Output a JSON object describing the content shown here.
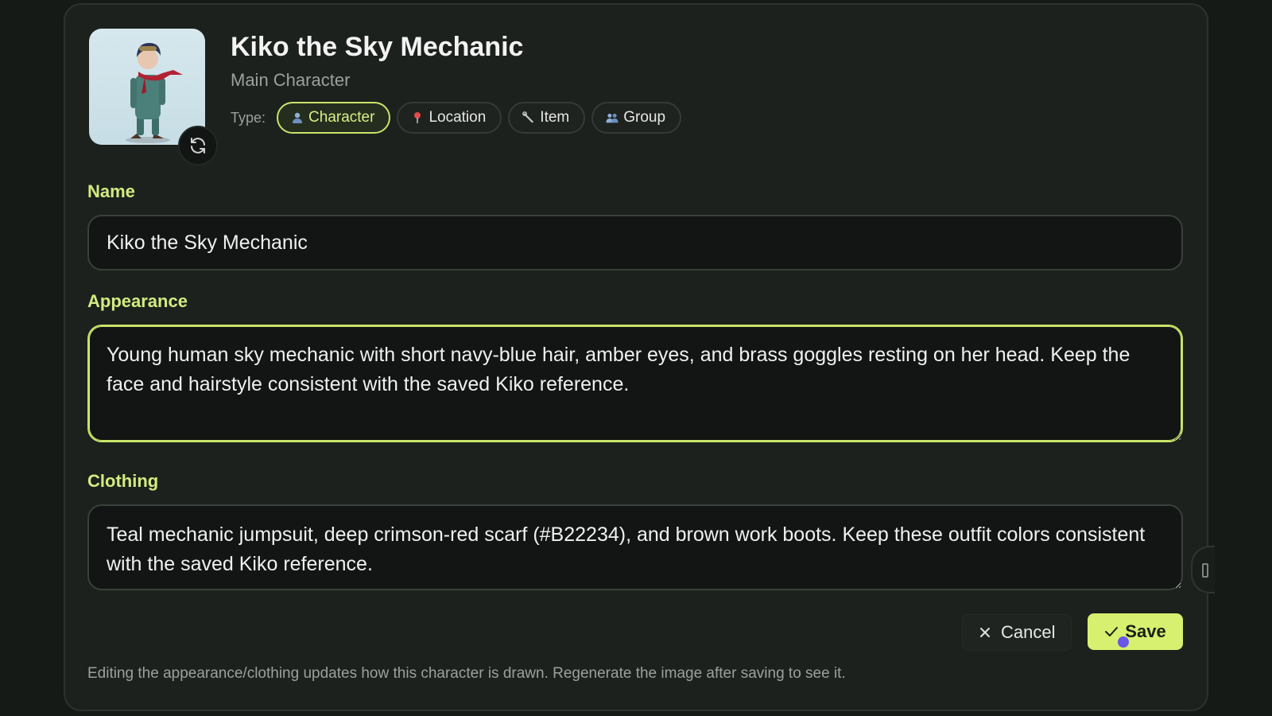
{
  "header": {
    "title": "Kiko the Sky Mechanic",
    "subtitle": "Main Character",
    "type_label": "Type:",
    "types": [
      {
        "label": "Character",
        "icon": "person-icon",
        "active": true
      },
      {
        "label": "Location",
        "icon": "pin-icon",
        "active": false
      },
      {
        "label": "Item",
        "icon": "wrench-icon",
        "active": false
      },
      {
        "label": "Group",
        "icon": "group-icon",
        "active": false
      }
    ]
  },
  "form": {
    "name_label": "Name",
    "name_value": "Kiko the Sky Mechanic",
    "appearance_label": "Appearance",
    "appearance_value": "Young human sky mechanic with short navy-blue hair, amber eyes, and brass goggles resting on her head. Keep the face and hairstyle consistent with the saved Kiko reference.",
    "clothing_label": "Clothing",
    "clothing_value": "Teal mechanic jumpsuit, deep crimson-red scarf (#B22234), and brown work boots. Keep these outfit colors consistent with the saved Kiko reference."
  },
  "actions": {
    "cancel_label": "Cancel",
    "save_label": "Save"
  },
  "hint": "Editing the appearance/clothing updates how this character is drawn. Regenerate the image after saving to see it.",
  "colors": {
    "accent": "#d7f06f",
    "background": "#161a17",
    "panel": "#1c211d",
    "scarf": "#B22234"
  }
}
